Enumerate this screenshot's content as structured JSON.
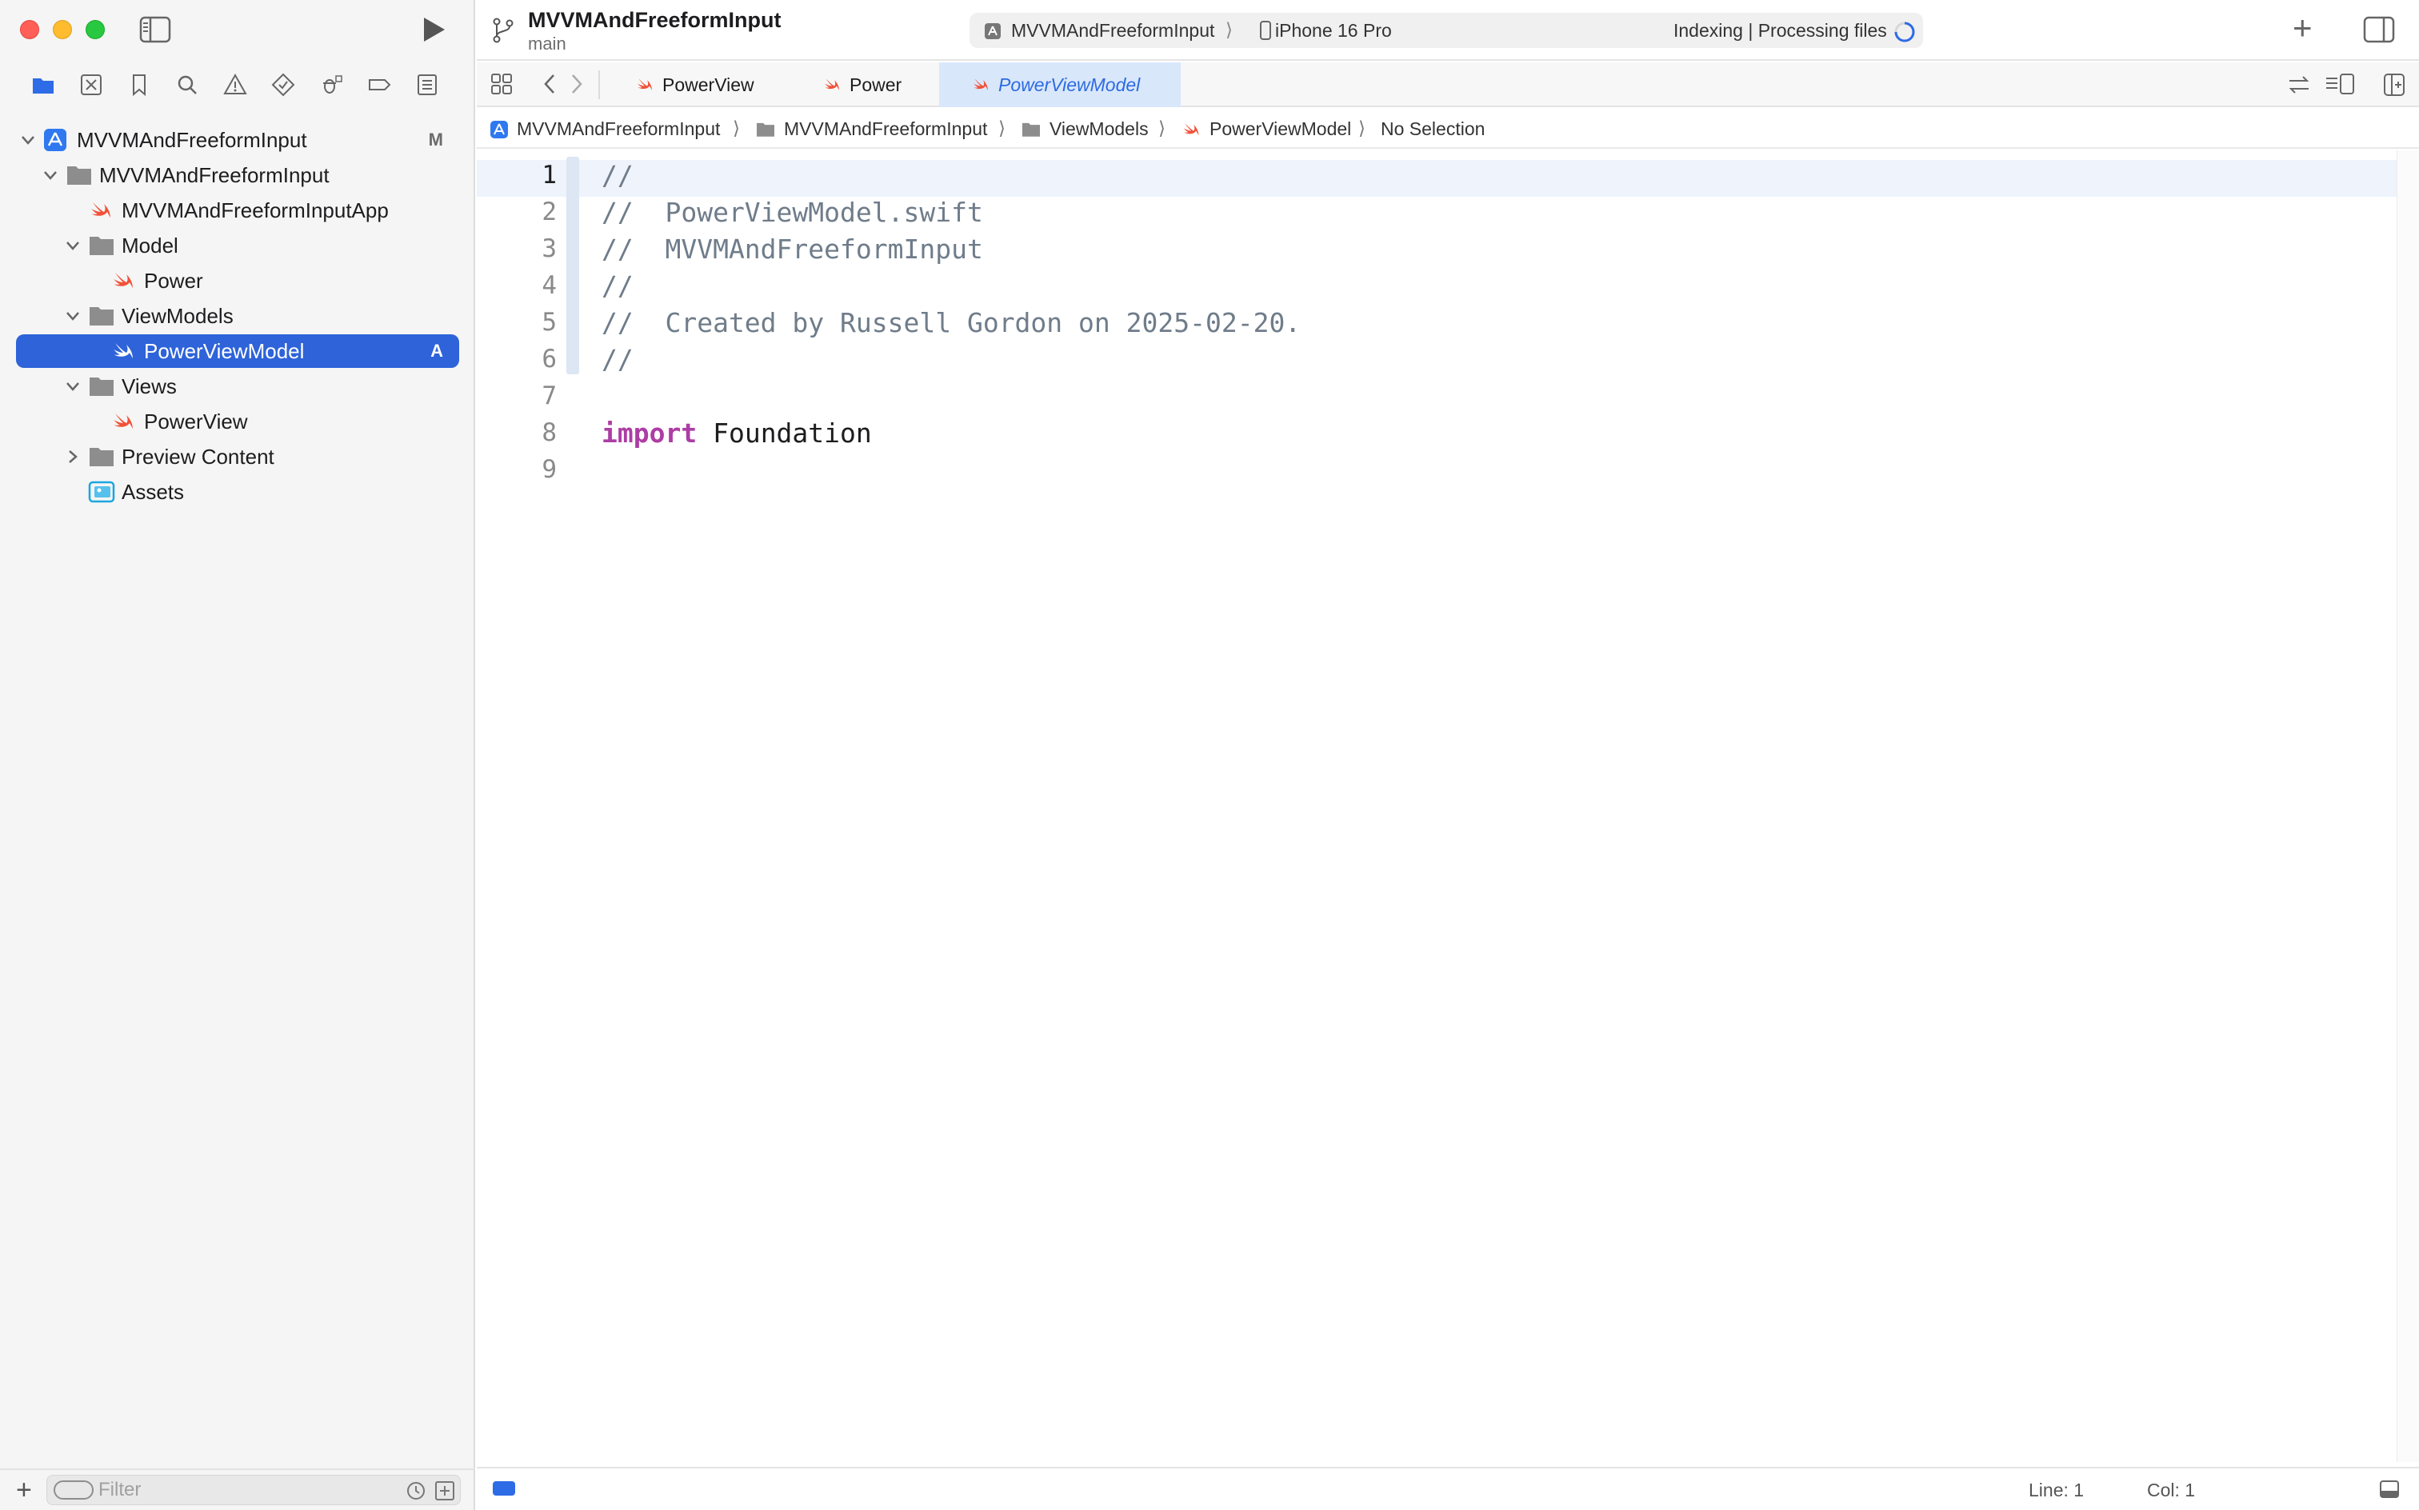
{
  "window": {
    "project_title": "MVVMAndFreeformInput",
    "branch": "main"
  },
  "activity": {
    "scheme": "MVVMAndFreeformInput",
    "separator": "⟩",
    "device": "iPhone 16 Pro",
    "status": "Indexing | Processing files"
  },
  "sidebar": {
    "nav_icons": [
      "folder-icon",
      "source-control-icon",
      "bookmark-icon",
      "find-icon",
      "issue-icon",
      "test-icon",
      "debug-icon",
      "breakpoint-icon",
      "report-icon"
    ],
    "tree": [
      {
        "label": "MVVMAndFreeformInput",
        "badge": "M",
        "type": "project",
        "level": 0,
        "expanded": true
      },
      {
        "label": "MVVMAndFreeformInput",
        "badge": "",
        "type": "folder",
        "level": 1,
        "expanded": true
      },
      {
        "label": "MVVMAndFreeformInputApp",
        "badge": "",
        "type": "swift",
        "level": 2
      },
      {
        "label": "Model",
        "badge": "",
        "type": "folder",
        "level": 2,
        "expanded": true
      },
      {
        "label": "Power",
        "badge": "",
        "type": "swift",
        "level": 3
      },
      {
        "label": "ViewModels",
        "badge": "",
        "type": "folder",
        "level": 2,
        "expanded": true
      },
      {
        "label": "PowerViewModel",
        "badge": "A",
        "type": "swift",
        "level": 3,
        "selected": true
      },
      {
        "label": "Views",
        "badge": "",
        "type": "folder",
        "level": 2,
        "expanded": true
      },
      {
        "label": "PowerView",
        "badge": "",
        "type": "swift",
        "level": 3
      },
      {
        "label": "Preview Content",
        "badge": "",
        "type": "folder",
        "level": 2,
        "expanded": false
      },
      {
        "label": "Assets",
        "badge": "",
        "type": "assets",
        "level": 2
      }
    ],
    "filter_placeholder": "Filter"
  },
  "tabs": [
    {
      "label": "PowerView",
      "active": false
    },
    {
      "label": "Power",
      "active": false
    },
    {
      "label": "PowerViewModel",
      "active": true
    }
  ],
  "breadcrumbs": [
    "MVVMAndFreeformInput",
    "MVVMAndFreeformInput",
    "ViewModels",
    "PowerViewModel",
    "No Selection"
  ],
  "breadcrumb_separator": "⟩",
  "editor": {
    "current_line": 1,
    "lines": [
      {
        "num": "1",
        "text": "//"
      },
      {
        "num": "2",
        "text": "//  PowerViewModel.swift"
      },
      {
        "num": "3",
        "text": "//  MVVMAndFreeformInput"
      },
      {
        "num": "4",
        "text": "//"
      },
      {
        "num": "5",
        "text": "//  Created by Russell Gordon on 2025-02-20."
      },
      {
        "num": "6",
        "text": "//"
      },
      {
        "num": "7",
        "text": ""
      },
      {
        "num": "8",
        "keyword": "import",
        "rest": " Foundation"
      },
      {
        "num": "9",
        "text": ""
      }
    ]
  },
  "status_bar": {
    "line": "Line: 1",
    "col": "Col: 1"
  },
  "colors": {
    "selection": "#2e63d9",
    "swift_icon": "#f05138",
    "folder": "#8d8d8d",
    "keyword": "#ad3da4",
    "comment": "#6f7c8a",
    "active_tab": "#2c6be0"
  }
}
